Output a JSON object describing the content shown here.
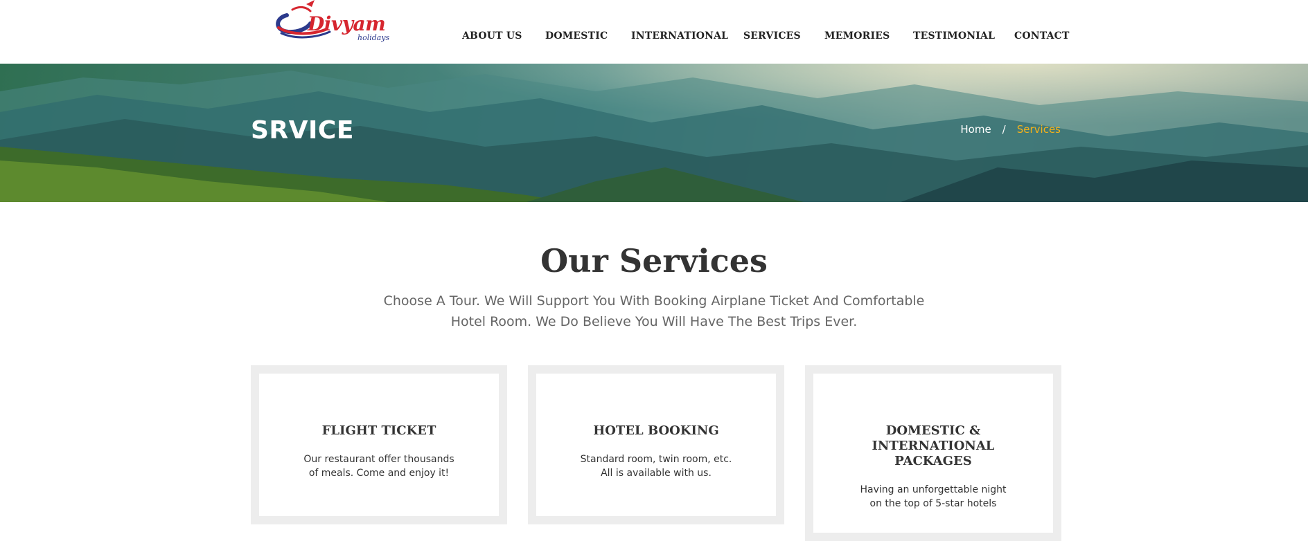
{
  "brand": {
    "logo_text": "Divyam",
    "logo_subtext": "holidays",
    "colors": {
      "red": "#d6262f",
      "blue": "#2c3a8c"
    }
  },
  "nav": {
    "items": [
      {
        "label": "ABOUT US"
      },
      {
        "label": "DOMESTIC"
      },
      {
        "label": "INTERNATIONAL"
      },
      {
        "label": "SERVICES"
      },
      {
        "label": "MEMORIES"
      },
      {
        "label": "TESTIMONIAL"
      },
      {
        "label": "CONTACT"
      }
    ]
  },
  "banner": {
    "title": "SRVICE",
    "breadcrumb": {
      "home": "Home",
      "separator": "/",
      "current": "Services"
    },
    "accent_color": "#f5b21a"
  },
  "services": {
    "title": "Our Services",
    "description": "Choose A Tour. We Will Support You With Booking Airplane Ticket And Comfortable Hotel Room. We Do Believe You Will Have The Best Trips Ever.",
    "cards": [
      {
        "title": "FLIGHT TICKET",
        "text": "Our restaurant offer thousands of meals. Come and enjoy it!"
      },
      {
        "title": "HOTEL BOOKING",
        "text": "Standard room, twin room, etc. All is available with us."
      },
      {
        "title": "DOMESTIC & INTERNATIONAL PACKAGES",
        "text": "Having an unforgettable night on the top of 5-star hotels"
      }
    ]
  }
}
